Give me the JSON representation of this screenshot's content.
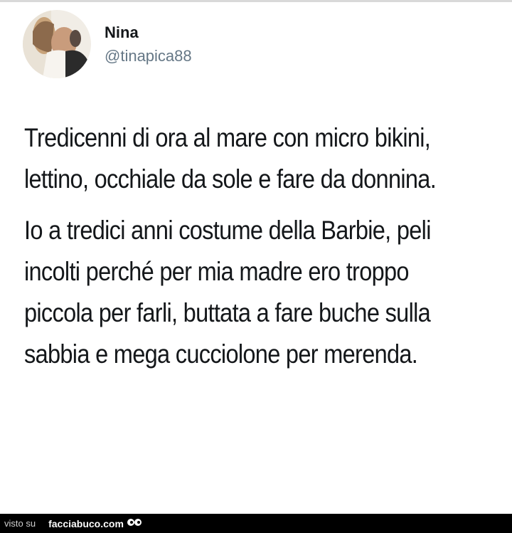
{
  "user": {
    "display_name": "Nina",
    "handle": "@tinapica88",
    "avatar_icon": "profile-photo-avatar"
  },
  "tweet": {
    "paragraphs": [
      "Tredicenni di ora al mare con micro bikini, lettino, occhiale da sole e fare da donnina.",
      "Io a tredici anni costume della Barbie, peli incolti perché per mia madre ero troppo piccola per farli, buttata a fare buche sulla sabbia e mega cucciolone per merenda."
    ]
  },
  "watermark": {
    "prefix": "visto su",
    "site": "facciabuco.com",
    "logo_icon": "eyes-icon"
  },
  "colors": {
    "text": "#14171a",
    "handle": "#657786",
    "watermark_bg": "#000000"
  }
}
